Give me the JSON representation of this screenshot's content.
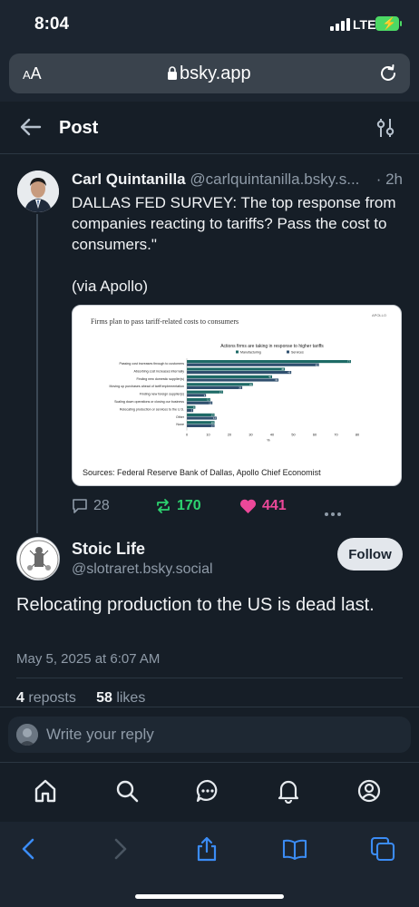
{
  "status_bar": {
    "time": "8:04",
    "network": "LTE"
  },
  "browser": {
    "text_size_label": "AA",
    "url": "bsky.app"
  },
  "header": {
    "title": "Post"
  },
  "parent_post": {
    "author_name": "Carl Quintanilla",
    "author_handle": "@carlquintanilla.bsky.s...",
    "time": "· 2h",
    "text": "DALLAS FED SURVEY: The top response from companies reacting to tariffs? Pass the cost to consumers.\"\n\n(via Apollo)",
    "embed": {
      "title": "Firms plan to pass tariff-related costs to consumers",
      "corner_label": "APOLLO",
      "source": "Sources: Federal Reserve Bank of Dallas, Apollo Chief Economist"
    },
    "reply_count": "28",
    "repost_count": "170",
    "like_count": "441"
  },
  "chart_data": {
    "type": "bar",
    "title": "Actions firms are taking in response to higher tariffs",
    "xlabel": "%",
    "xlim": [
      0,
      80
    ],
    "xticks": [
      "0",
      "10",
      "20",
      "30",
      "40",
      "50",
      "60",
      "70",
      "80"
    ],
    "categories": [
      "Passing cost increases through to customers",
      "Absorbing cost increases internally",
      "Finding new domestic supplier(s)",
      "Moving up purchases ahead of tariff implementation",
      "Finding new foreign supplier(s)",
      "Scaling down operations or closing our business",
      "Relocating production or services to the U.S.",
      "Other",
      "None"
    ],
    "series": [
      {
        "name": "Manufacturing",
        "color": "#1d6a66",
        "values": [
          77,
          46,
          40,
          31,
          17,
          11,
          4,
          13,
          13
        ]
      },
      {
        "name": "Services",
        "color": "#2f4f6e",
        "values": [
          62,
          49,
          43,
          26,
          9,
          12,
          3,
          14,
          13
        ]
      }
    ],
    "legend": "top"
  },
  "reply_post": {
    "author_name": "Stoic Life",
    "author_handle": "@slotraret.bsky.social",
    "follow_label": "Follow",
    "text": "Relocating production to the US is dead last.",
    "date": "May 5, 2025 at 6:07 AM",
    "reposts_count": "4",
    "reposts_label": "reposts",
    "likes_count": "58",
    "likes_label": "likes"
  },
  "reply_bar": {
    "placeholder": "Write your reply"
  },
  "colors": {
    "background": "#161e27",
    "repost": "#2dd36f",
    "like": "#ec4899",
    "muted": "#8f9ba8"
  }
}
